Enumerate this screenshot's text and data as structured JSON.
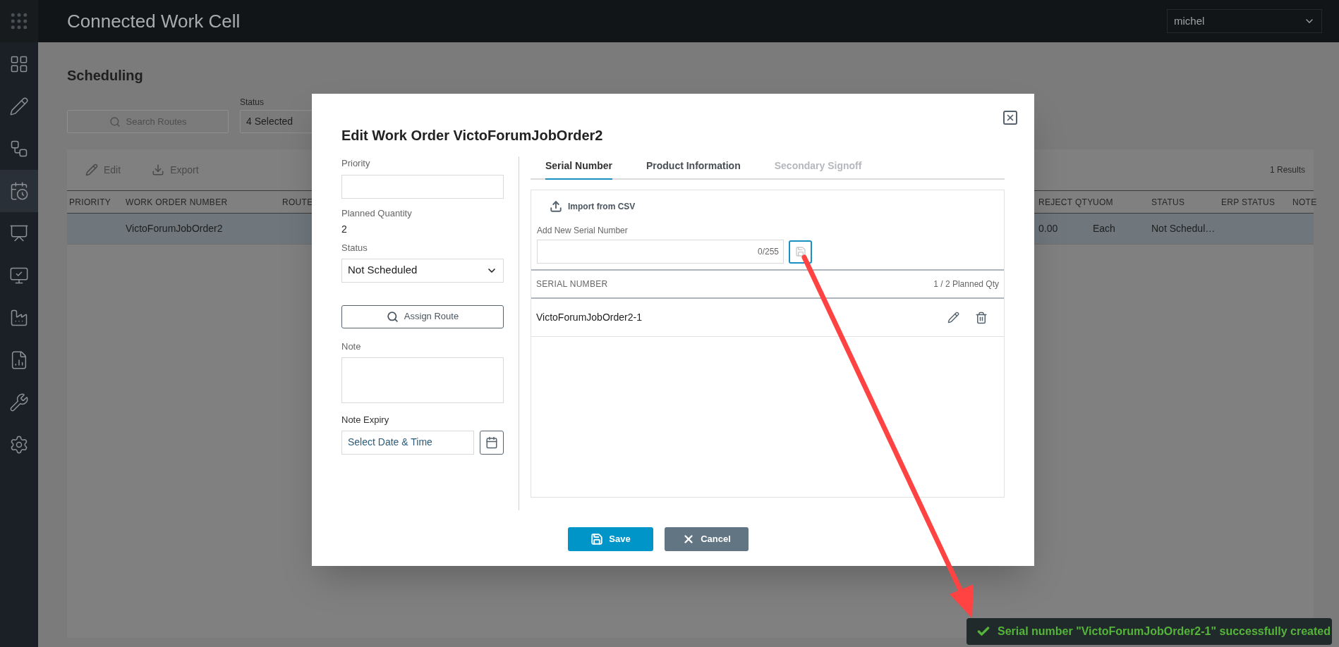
{
  "app": {
    "title": "Connected Work Cell",
    "user": "michel"
  },
  "sidebar": {
    "items": [
      {
        "selected": false
      },
      {
        "selected": false
      },
      {
        "selected": false
      },
      {
        "selected": true
      },
      {
        "selected": false
      },
      {
        "selected": false
      },
      {
        "selected": false
      },
      {
        "selected": false
      },
      {
        "selected": false
      },
      {
        "selected": false
      }
    ]
  },
  "page": {
    "title": "Scheduling",
    "search_placeholder": "Search Routes",
    "status_label": "Status",
    "status_value": "4 Selected",
    "toolbar": [
      {
        "kind": "edit",
        "label": "Edit"
      },
      {
        "kind": "export",
        "label": "Export"
      }
    ],
    "results": "1 Results",
    "columns_left": [
      "PRIORITY",
      "WORK ORDER NUMBER",
      "ROUTE"
    ],
    "columns_right": [
      "REJECT QTY",
      "UOM",
      "STATUS",
      "ERP STATUS",
      "NOTE"
    ],
    "rows": [
      {
        "selected": true,
        "work_order_number": "VictoForumJobOrder2",
        "reject_qty": "0.00",
        "uom": "Each",
        "status": "Not Schedul…"
      }
    ]
  },
  "dialog": {
    "title": "Edit Work Order VictoForumJobOrder2",
    "priority_label": "Priority",
    "planned_quantity_label": "Planned Quantity",
    "planned_quantity": "2",
    "status_label": "Status",
    "status_value": "Not Scheduled",
    "assign_route": "Assign Route",
    "note_label": "Note",
    "note_expiry_label": "Note Expiry",
    "note_expiry_placeholder": "Select Date & Time",
    "tabs": [
      {
        "label": "Serial Number",
        "selected": true,
        "disabled": false
      },
      {
        "label": "Product Information",
        "selected": false,
        "disabled": false
      },
      {
        "label": "Secondary Signoff",
        "selected": false,
        "disabled": true
      }
    ],
    "import_button": "Import from CSV",
    "new_serial_label": "Add New Serial Number",
    "char_count": "0/255",
    "list_header": "SERIAL NUMBER",
    "planned_qty": "1 / 2 Planned Qty",
    "serials": [
      {
        "value": "VictoForumJobOrder2-1"
      }
    ],
    "save": "Save",
    "cancel": "Cancel"
  },
  "toast": {
    "kind": "success",
    "message": "Serial number \"VictoForumJobOrder2-1\" successfully created"
  }
}
